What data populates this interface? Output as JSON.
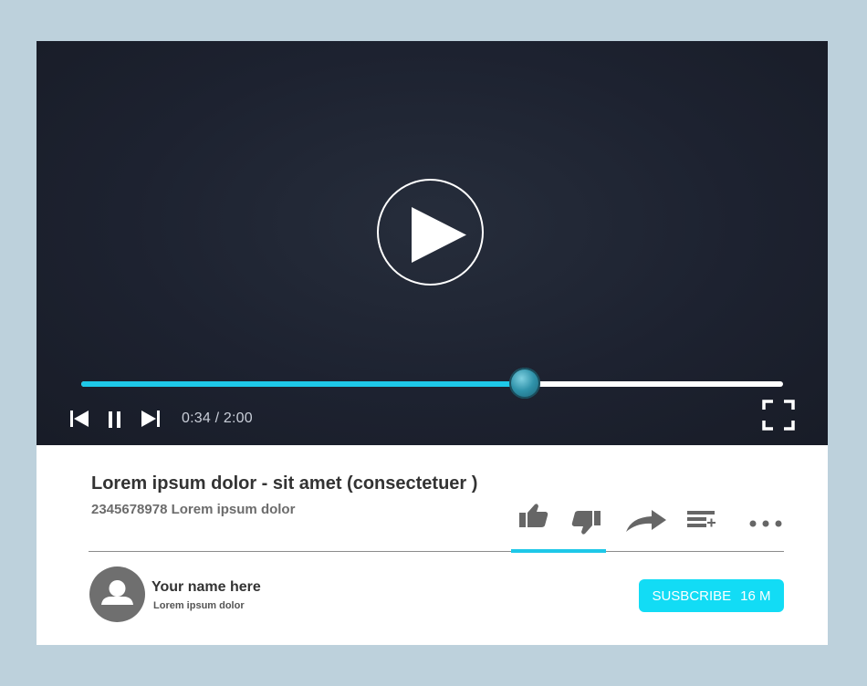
{
  "player": {
    "time_display": "0:34 / 2:00",
    "progress_fraction": 0.632,
    "accent_color": "#1ec8e8"
  },
  "video": {
    "title": "Lorem ipsum dolor -  sit amet (consectetuer )",
    "subtitle": "2345678978 Lorem ipsum dolor"
  },
  "actions": [
    {
      "icon": "thumbs-up-icon"
    },
    {
      "icon": "thumbs-down-icon"
    },
    {
      "icon": "share-icon"
    },
    {
      "icon": "add-to-playlist-icon"
    },
    {
      "icon": "more-icon"
    }
  ],
  "channel": {
    "name": "Your name here",
    "description": "Lorem ipsum dolor",
    "subscribe_label": "SUSBCRIBE",
    "subscriber_count": "16 M"
  }
}
